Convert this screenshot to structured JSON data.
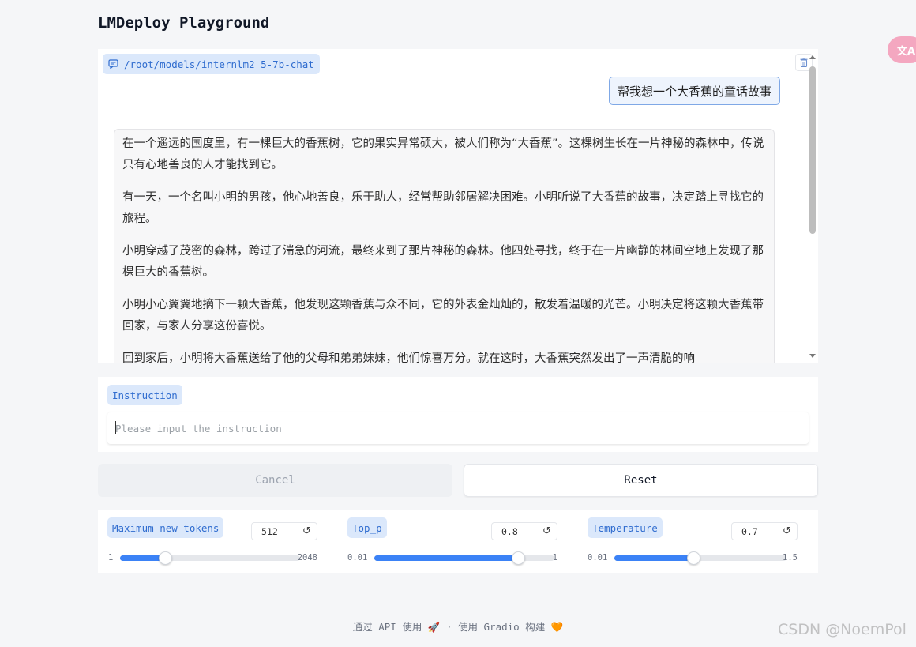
{
  "app": {
    "title": "LMDeploy Playground"
  },
  "translate_button": {
    "label": "文A"
  },
  "chat": {
    "model_label": "/root/models/internlm2_5-7b-chat",
    "user_message": "帮我想一个大香蕉的童话故事",
    "assistant_paragraphs": [
      "在一个遥远的国度里，有一棵巨大的香蕉树，它的果实异常硕大，被人们称为“大香蕉”。这棵树生长在一片神秘的森林中，传说只有心地善良的人才能找到它。",
      "有一天，一个名叫小明的男孩，他心地善良，乐于助人，经常帮助邻居解决困难。小明听说了大香蕉的故事，决定踏上寻找它的旅程。",
      "小明穿越了茂密的森林，跨过了湍急的河流，最终来到了那片神秘的森林。他四处寻找，终于在一片幽静的林间空地上发现了那棵巨大的香蕉树。",
      "小明小心翼翼地摘下一颗大香蕉，他发现这颗香蕉与众不同，它的外表金灿灿的，散发着温暖的光芒。小明决定将这颗大香蕉带回家，与家人分享这份喜悦。",
      "回到家后，小明将大香蕉送给了他的父母和弟弟妹妹，他们惊喜万分。就在这时，大香蕉突然发出了一声清脆的响"
    ]
  },
  "instruction": {
    "label": "Instruction",
    "value": "",
    "placeholder": "Please input the instruction"
  },
  "buttons": {
    "cancel": "Cancel",
    "reset": "Reset"
  },
  "sliders": [
    {
      "label": "Maximum new tokens",
      "value": "512",
      "min": "1",
      "max": "2048",
      "fraction": 0.25
    },
    {
      "label": "Top_p",
      "value": "0.8",
      "min": "0.01",
      "max": "1",
      "fraction": 0.8
    },
    {
      "label": "Temperature",
      "value": "0.7",
      "min": "0.01",
      "max": "1.5",
      "fraction": 0.46
    }
  ],
  "reset_icon": "↺",
  "footer": {
    "text": "通过 API 使用 🚀 · 使用 Gradio 构建 🧡"
  },
  "watermark": "CSDN @NoemPol",
  "colors": {
    "accent": "#3b82f6",
    "label_bg": "#dbe8fb",
    "label_text": "#2f6ccf",
    "translate_button": "#f4a7c0"
  }
}
